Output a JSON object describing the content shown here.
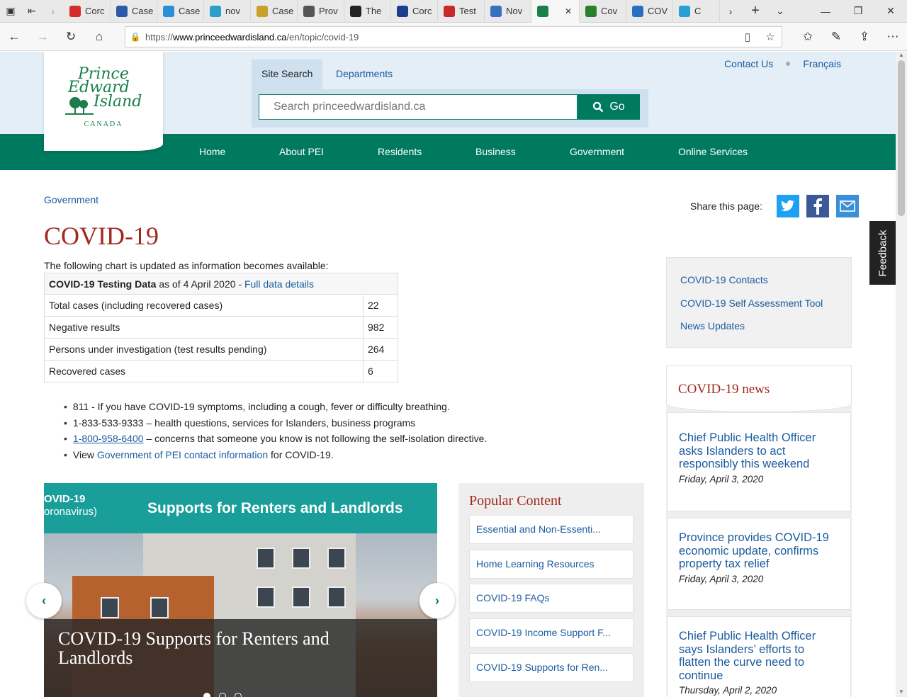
{
  "browser": {
    "tabs": [
      {
        "label": "Corc",
        "color": "#d62b2b"
      },
      {
        "label": "Case",
        "color": "#2a5aa8"
      },
      {
        "label": "Case",
        "color": "#2b8fd6"
      },
      {
        "label": "nov",
        "color": "#2aa0c8"
      },
      {
        "label": "Case",
        "color": "#c8a02a"
      },
      {
        "label": "Prov",
        "color": "#555555"
      },
      {
        "label": "The",
        "color": "#222222"
      },
      {
        "label": "Corc",
        "color": "#1a3f8f"
      },
      {
        "label": "Test",
        "color": "#c82a2a"
      },
      {
        "label": "Nov",
        "color": "#3a6ec0"
      },
      {
        "label": "",
        "color": "#1a7f4b",
        "active": true
      },
      {
        "label": "Cov",
        "color": "#2a7f2a"
      },
      {
        "label": "COV",
        "color": "#2a6ec0"
      },
      {
        "label": "C",
        "color": "#2a9fd6"
      }
    ],
    "url_prefix": "https://",
    "url_domain": "www.princeedwardisland.ca",
    "url_path": "/en/topic/covid-19"
  },
  "header": {
    "logo_line1": "Prince",
    "logo_line2": "Edward",
    "logo_line3": "Island",
    "logo_canada": "CANADA",
    "search_tab_site": "Site Search",
    "search_tab_departments": "Departments",
    "search_placeholder": "Search princeedwardisland.ca",
    "search_button": "Go",
    "contact_us": "Contact Us",
    "francais": "Français"
  },
  "nav": {
    "home": "Home",
    "about": "About PEI",
    "residents": "Residents",
    "business": "Business",
    "government": "Government",
    "online": "Online Services"
  },
  "main": {
    "breadcrumb": "Government",
    "share_label": "Share this page:",
    "title": "COVID-19",
    "intro": "The following chart is updated as information becomes available:",
    "table": {
      "caption_bold": "COVID-19 Testing Data",
      "caption_rest": " as of 4 April 2020 - ",
      "caption_link": "Full data details",
      "rows": [
        {
          "label": "Total cases (including recovered cases)",
          "value": "22"
        },
        {
          "label": "Negative results",
          "value": "982"
        },
        {
          "label": "Persons under investigation (test results pending)",
          "value": "264"
        },
        {
          "label": "Recovered cases",
          "value": "6"
        }
      ]
    },
    "bullets": {
      "b1": "811 - If you have COVID-19 symptoms, including a cough, fever or difficulty breathing.",
      "b2": "1-833-533-9333 – health questions, services for Islanders, business programs",
      "b3_link": "1-800-958-6400",
      "b3_rest": " – concerns that someone you know is not following the self-isolation directive.",
      "b4_pre": "View ",
      "b4_link": "Government of PEI contact information",
      "b4_post": " for COVID-19."
    }
  },
  "carousel": {
    "banner_line1": "OVID-19",
    "banner_line2": "oronavirus)",
    "banner_title": "Supports for Renters and Landlords",
    "caption": "COVID-19 Supports for Renters and Landlords"
  },
  "popular": {
    "title": "Popular Content",
    "items": [
      "Essential and Non-Essenti...",
      "Home Learning Resources",
      "COVID-19 FAQs",
      "COVID-19 Income Support F...",
      "COVID-19 Supports for Ren..."
    ]
  },
  "quicklinks": {
    "l1": "COVID-19 Contacts",
    "l2": "COVID-19 Self Assessment Tool",
    "l3": "News Updates"
  },
  "news": {
    "title": "COVID-19 news",
    "items": [
      {
        "title": "Chief Public Health Officer asks Islanders to act responsibly this weekend",
        "date": "Friday, April 3, 2020"
      },
      {
        "title": "Province provides COVID-19 economic update, confirms property tax relief",
        "date": "Friday, April 3, 2020"
      },
      {
        "title": "Chief Public Health Officer says Islanders’ efforts to flatten the curve need to continue",
        "date": "Thursday, April 2, 2020"
      }
    ]
  },
  "feedback": "Feedback",
  "colors": {
    "brand_green": "#007a5e",
    "title_red": "#a3281e",
    "link_blue": "#1a5b9e",
    "twitter": "#1da1f2",
    "facebook": "#3b5998",
    "email": "#3a8fd6"
  }
}
